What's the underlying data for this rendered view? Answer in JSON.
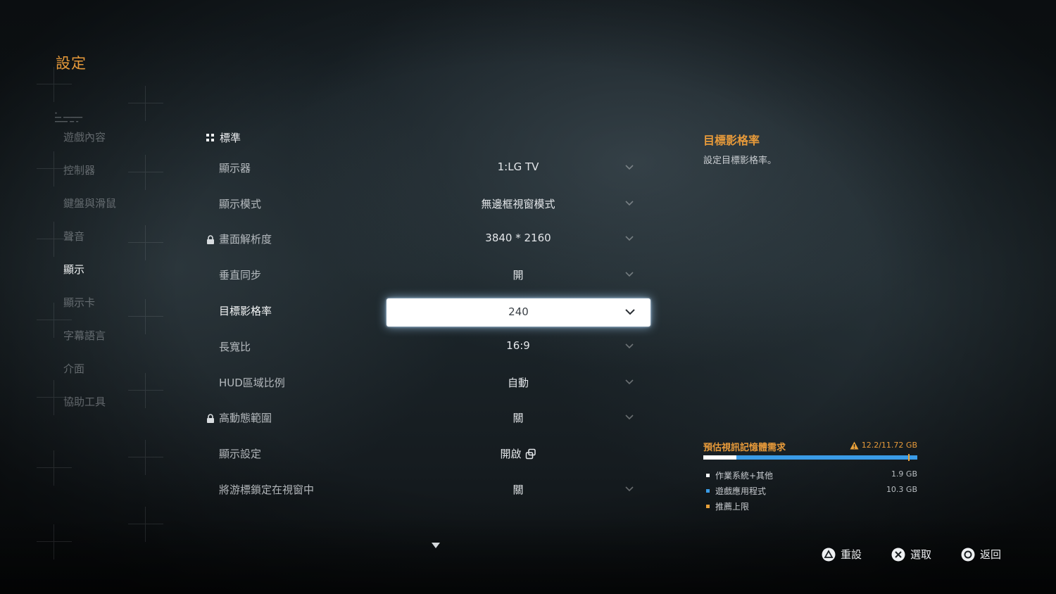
{
  "page": {
    "title": "設定"
  },
  "sidebar": {
    "items": [
      {
        "label": "遊戲內容",
        "active": false
      },
      {
        "label": "控制器",
        "active": false
      },
      {
        "label": "鍵盤與滑鼠",
        "active": false
      },
      {
        "label": "聲音",
        "active": false
      },
      {
        "label": "顯示",
        "active": true
      },
      {
        "label": "顯示卡",
        "active": false
      },
      {
        "label": "字幕語言",
        "active": false
      },
      {
        "label": "介面",
        "active": false
      },
      {
        "label": "協助工具",
        "active": false
      }
    ]
  },
  "section": {
    "title": "標準"
  },
  "settings": [
    {
      "label": "顯示器",
      "value": "1:LG TV",
      "locked": false
    },
    {
      "label": "顯示模式",
      "value": "無邊框視窗模式",
      "locked": false
    },
    {
      "label": "畫面解析度",
      "value": "3840 * 2160",
      "locked": true
    },
    {
      "label": "垂直同步",
      "value": "開",
      "locked": false
    },
    {
      "label": "目標影格率",
      "value": "240",
      "locked": false,
      "selected": true
    },
    {
      "label": "長寬比",
      "value": "16:9",
      "locked": false
    },
    {
      "label": "HUD區域比例",
      "value": "自動",
      "locked": false
    },
    {
      "label": "高動態範圍",
      "value": "關",
      "locked": true
    },
    {
      "label": "顯示設定",
      "value": "開啟",
      "locked": false,
      "external": true
    },
    {
      "label": "將游標鎖定在視窗中",
      "value": "關",
      "locked": false
    }
  ],
  "help": {
    "title": "目標影格率",
    "description": "設定目標影格率。"
  },
  "vram": {
    "title": "預估視訊記憶體需求",
    "total": "12.2/11.72 GB",
    "used_gb": 12.2,
    "limit_gb": 11.72,
    "segments": [
      {
        "label": "作業系統+其他",
        "value": "1.9 GB",
        "gb": 1.9,
        "color": "#ffffff"
      },
      {
        "label": "遊戲應用程式",
        "value": "10.3 GB",
        "gb": 10.3,
        "color": "#3a9be6"
      },
      {
        "label": "推薦上限",
        "value": "",
        "color": "#e9a13a"
      }
    ]
  },
  "footer": {
    "reset_label": "重設",
    "select_label": "選取",
    "back_label": "返回"
  },
  "colors": {
    "accent": "#e79a3a",
    "blue": "#3a9be6"
  }
}
